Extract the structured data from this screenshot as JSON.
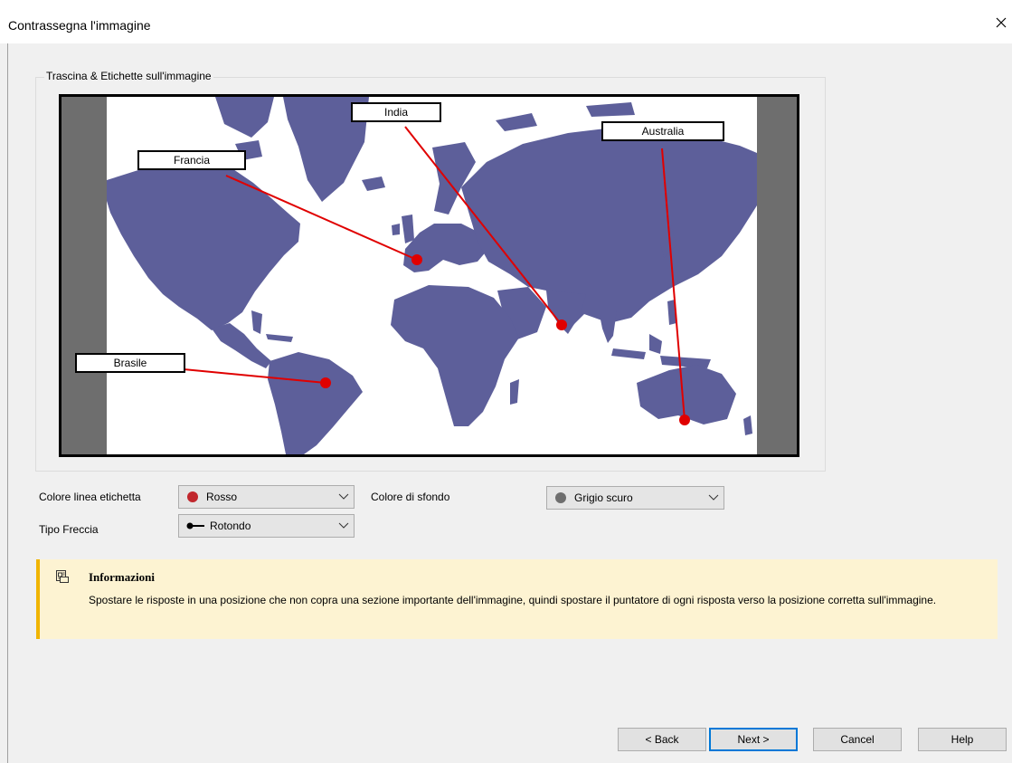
{
  "window": {
    "title": "Contrassegna l'immagine"
  },
  "group": {
    "label": "Trascina & Etichette sull'immagine"
  },
  "labels": {
    "francia": "Francia",
    "india": "India",
    "australia": "Australia",
    "brasile": "Brasile"
  },
  "colors": {
    "line": "#e00000",
    "land": "#5d5f9a",
    "map_background": "#ffffff",
    "canvas_background": "#6e6e6e",
    "info_accent": "#f0b400"
  },
  "options": {
    "line_color_label": "Colore linea etichetta",
    "line_color_value": "Rosso",
    "line_color_swatch": "#c1272d",
    "arrow_type_label": "Tipo Freccia",
    "arrow_type_value": "Rotondo",
    "background_label": "Colore di sfondo",
    "background_value": "Grigio scuro",
    "background_swatch": "#6e6e6e"
  },
  "info": {
    "icon": "info-panel-icon",
    "title": "Informazioni",
    "text": "Spostare le risposte in una posizione che non copra una sezione importante dell'immagine, quindi spostare il puntatore di ogni risposta verso la posizione corretta sull'immagine."
  },
  "buttons": {
    "back": "< Back",
    "next": "Next >",
    "cancel": "Cancel",
    "help": "Help"
  }
}
